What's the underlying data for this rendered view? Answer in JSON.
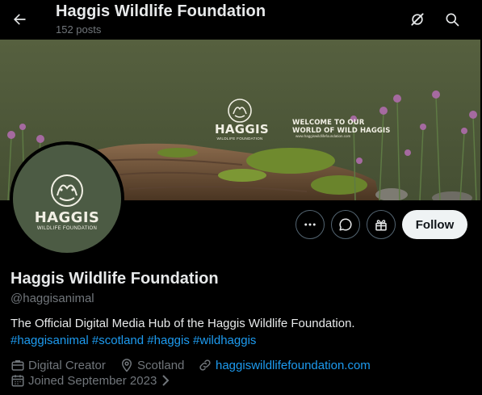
{
  "header": {
    "title": "Haggis Wildlife Foundation",
    "post_count": "152 posts",
    "back_icon": "arrow-left-icon",
    "grok_icon": "grok-icon",
    "search_icon": "search-icon"
  },
  "banner": {
    "logo_name": "HAGGIS",
    "logo_sub": "WILDLIFE FOUNDATION",
    "welcome_text": "WELCOME TO OUR\nWORLD OF WILD HAGGIS",
    "url_text": "www.haggiswildlifefoundation.com"
  },
  "avatar": {
    "name": "HAGGIS",
    "sub": "WILDLIFE FOUNDATION"
  },
  "actions": {
    "more_icon": "more-icon",
    "message_icon": "message-icon",
    "subscribe_icon": "gift-icon",
    "follow_label": "Follow"
  },
  "profile": {
    "display_name": "Haggis Wildlife Foundation",
    "handle": "@haggisanimal",
    "bio": "The Official Digital Media Hub of the Haggis Wildlife Foundation.",
    "hashtags": [
      "#haggisanimal",
      "#scotland",
      "#haggis",
      "#wildhaggis"
    ],
    "category": "Digital Creator",
    "location": "Scotland",
    "website": "haggiswildlifefoundation.com",
    "joined": "Joined September 2023"
  },
  "colors": {
    "background": "#000000",
    "link": "#1d9bf0",
    "muted": "#71767b",
    "banner_green": "#4f5a3a",
    "avatar_green": "#4c5b44"
  }
}
